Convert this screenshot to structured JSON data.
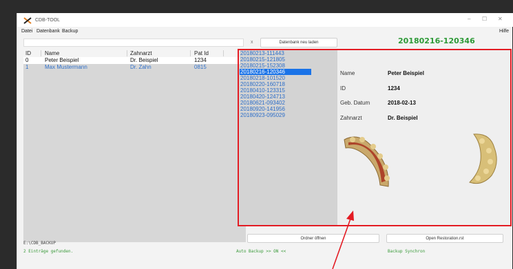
{
  "window": {
    "title": "CDB-TOOL",
    "controls": {
      "minimize": "–",
      "maximize": "☐",
      "close": "✕"
    }
  },
  "menu": {
    "items": [
      "Datei",
      "Datenbank",
      "Backup"
    ],
    "help": "Hilfe"
  },
  "toolbar": {
    "search_value": "",
    "clear_label": "x",
    "reload_label": "Datenbank neu laden",
    "selected_id": "20180216-120346"
  },
  "table": {
    "columns": [
      "ID",
      "Name",
      "Zahnarzt",
      "Pat Id"
    ],
    "rows": [
      [
        "0",
        "Peter Beispiel",
        "Dr. Beispiel",
        "1234"
      ],
      [
        "1",
        "Max Mustermann",
        "Dr. Zahn",
        "0815"
      ]
    ]
  },
  "dates": {
    "items": [
      "20180213-111443",
      "20180215-121805",
      "20180215-152308",
      "20180216-120346",
      "20180218-101520",
      "20180220-160718",
      "20180410-123315",
      "20180420-124713",
      "20180621-093402",
      "20180920-141956",
      "20180923-095029"
    ],
    "selected_index": 3
  },
  "details": {
    "name_label": "Name",
    "name_value": "Peter Beispiel",
    "id_label": "ID",
    "id_value": "1234",
    "dob_label": "Geb. Datum",
    "dob_value": "2018-02-13",
    "dentist_label": "Zahnarzt",
    "dentist_value": "Dr. Beispiel"
  },
  "footer": {
    "path": "E:\\CDB_BACKUP",
    "found": "2 Einträge gefunden.",
    "open_folder": "Ordner öffnen",
    "open_restoration": "Open Restoration.rst",
    "auto_backup": "Auto Backup >> ON <<",
    "backup_sync": "Backup Synchron"
  },
  "colors": {
    "accent_green": "#2d9a37",
    "link_blue": "#2e6fc9",
    "selection_blue": "#1a73e8",
    "highlight_red": "#e31b23"
  }
}
